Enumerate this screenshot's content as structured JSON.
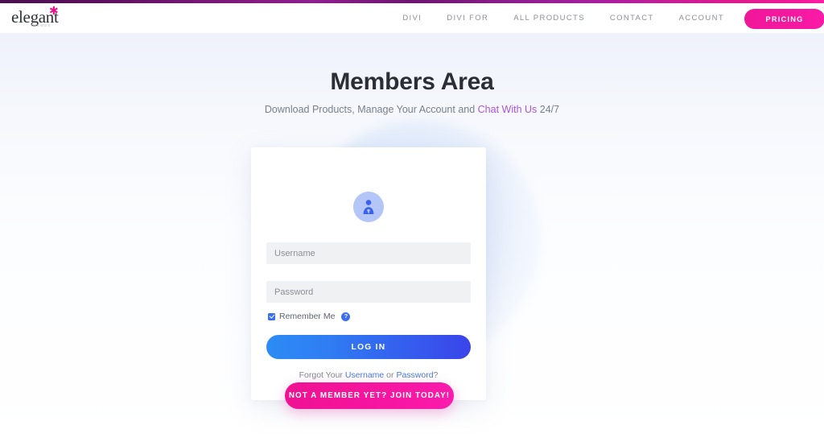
{
  "topbar": {
    "present": true,
    "accent_color": "#8e2090"
  },
  "header": {
    "logo": {
      "word": "elegant",
      "sub": "themes",
      "star_icon": "star-icon",
      "star_color": "#e6158e"
    },
    "nav": [
      {
        "label": "DIVI"
      },
      {
        "label": "DIVI FOR"
      },
      {
        "label": "ALL PRODUCTS"
      },
      {
        "label": "CONTACT"
      },
      {
        "label": "ACCOUNT"
      }
    ],
    "pricing_button": {
      "label": "PRICING",
      "color": "#f4189e"
    }
  },
  "hero": {
    "title": "Members Area",
    "subtitle_before": "Download Products, Manage Your Account and ",
    "subtitle_link": "Chat With Us",
    "subtitle_after": " 24/7",
    "link_color": "#ab55d6"
  },
  "login": {
    "avatar_icon": "user-lock-avatar-icon",
    "avatar_color": "#b3c6f7",
    "username": {
      "value": "",
      "placeholder": "Username"
    },
    "password": {
      "value": "",
      "placeholder": "Password"
    },
    "remember": {
      "label": "Remember Me",
      "checked": true,
      "help_icon": "help-question-icon",
      "help_glyph": "?"
    },
    "submit_label": "LOG IN",
    "submit_color": "#3463ef",
    "forgot_before": "Forgot Your ",
    "forgot_username": "Username",
    "forgot_middle": " or ",
    "forgot_password": "Password",
    "forgot_after": "?"
  },
  "cta": {
    "join_label": "NOT A MEMBER YET? JOIN TODAY!",
    "join_color": "#f5149c"
  }
}
